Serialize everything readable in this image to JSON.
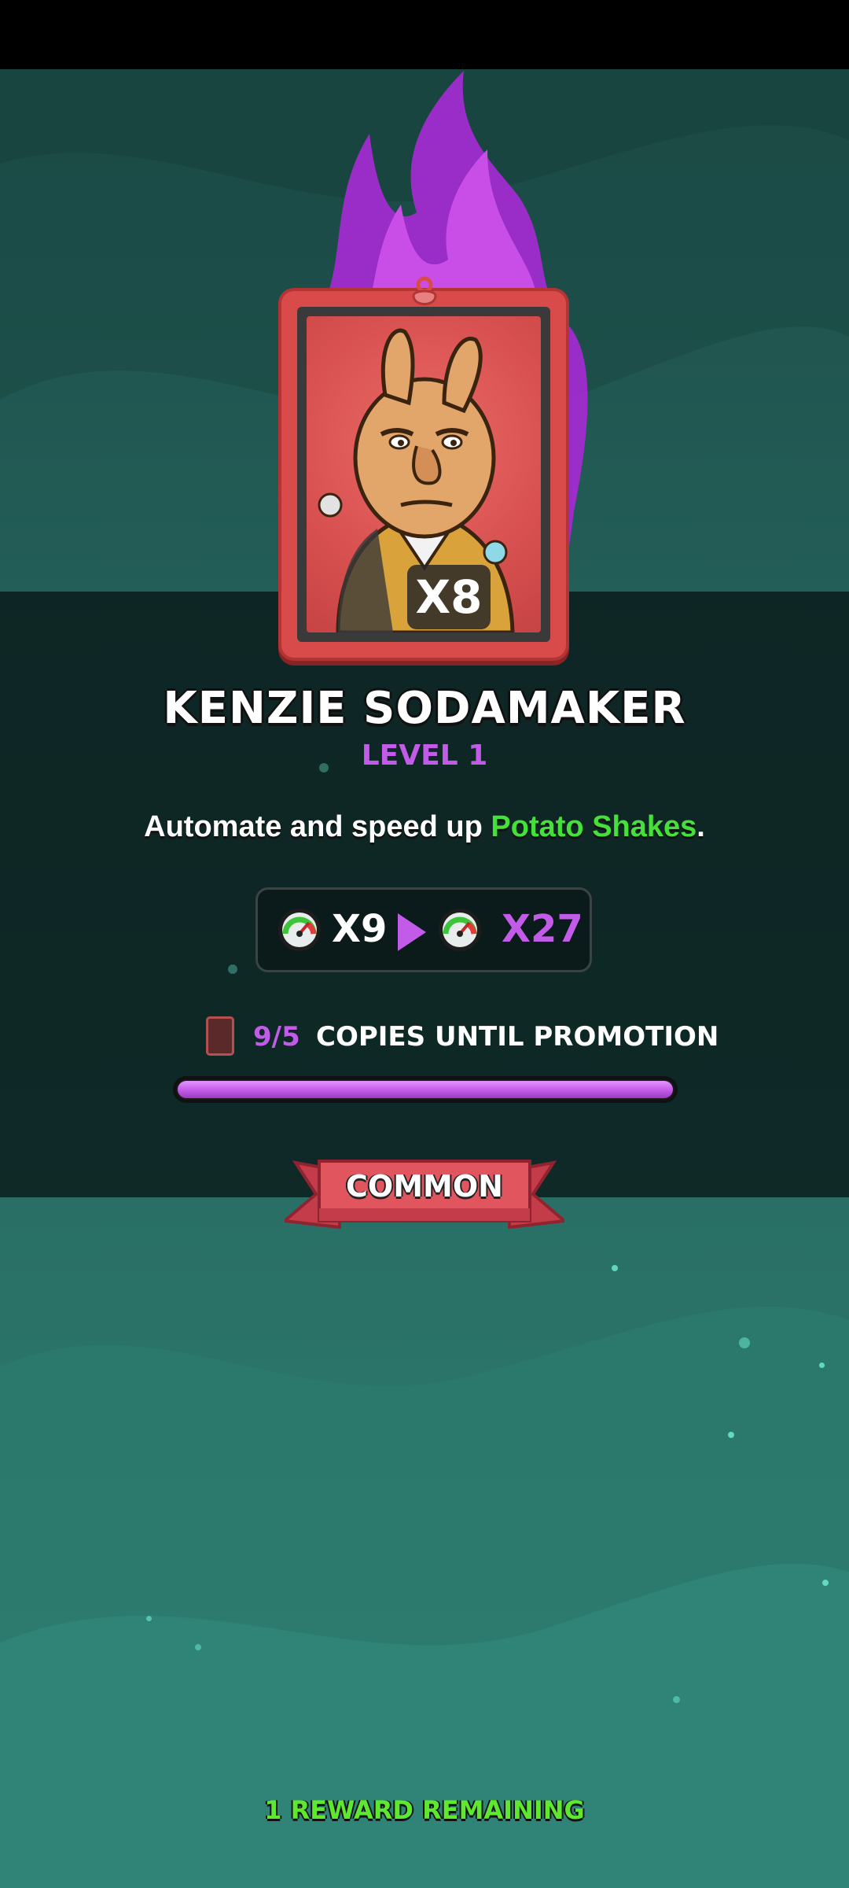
{
  "character": {
    "name": "KENZIE SODAMAKER",
    "level": "LEVEL 1",
    "multiplier": "X8",
    "description_prefix": "Automate and speed up ",
    "description_highlight": "Potato Shakes",
    "description_suffix": "."
  },
  "speed_upgrade": {
    "current": "X9",
    "next": "X27",
    "icon": "speedometer-icon"
  },
  "promotion": {
    "copies_count": "9/5",
    "label": "COPIES UNTIL PROMOTION",
    "progress_fraction": 1.0
  },
  "rarity": "COMMON",
  "footer": {
    "rewards_remaining": "1 REWARD REMAINING"
  },
  "colors": {
    "accent_purple": "#c15be8",
    "highlight_green": "#45e03a",
    "reward_green": "#5ee82e",
    "card_red": "#d94b4b",
    "background_teal": "#24605a"
  }
}
